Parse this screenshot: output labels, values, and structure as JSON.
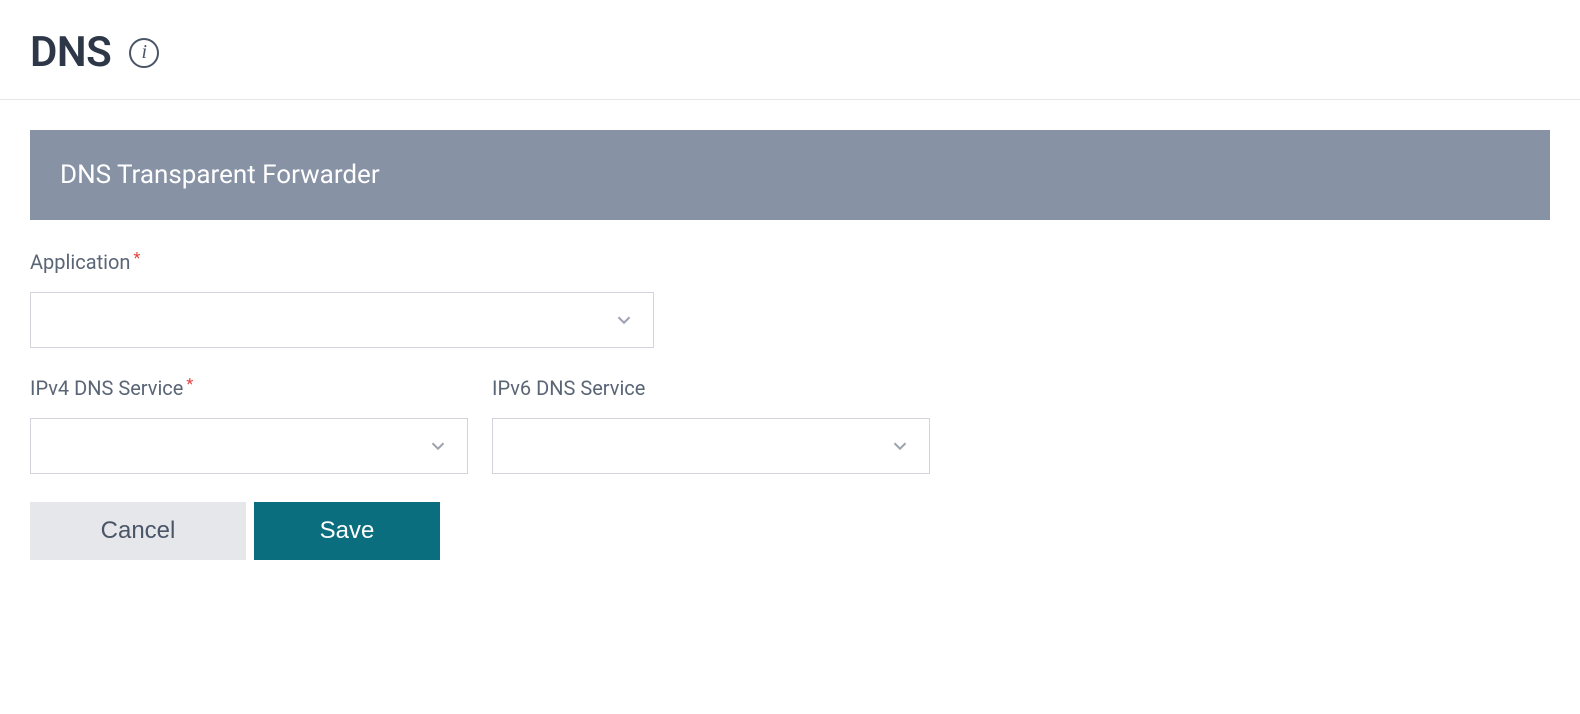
{
  "header": {
    "title": "DNS",
    "info_glyph": "i"
  },
  "section": {
    "title": "DNS Transparent Forwarder"
  },
  "form": {
    "application": {
      "label": "Application",
      "required": true,
      "value": ""
    },
    "ipv4_service": {
      "label": "IPv4 DNS Service",
      "required": true,
      "value": ""
    },
    "ipv6_service": {
      "label": "IPv6 DNS Service",
      "required": false,
      "value": ""
    }
  },
  "buttons": {
    "cancel": "Cancel",
    "save": "Save"
  },
  "required_marker": "*"
}
